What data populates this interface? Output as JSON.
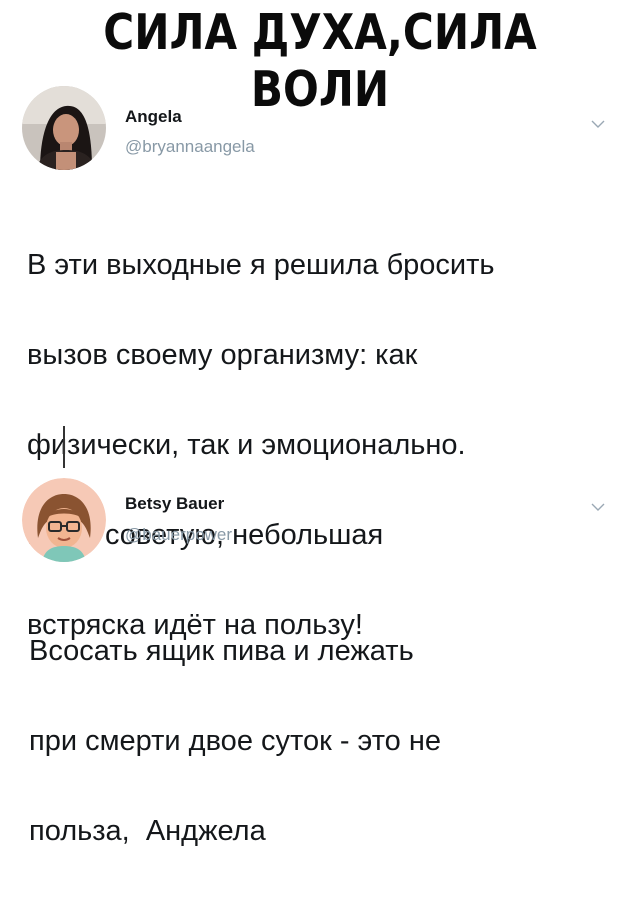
{
  "meme": {
    "title": "СИЛА ДУХА,СИЛА ВОЛИ"
  },
  "tweet1": {
    "name": "Angela",
    "handle": "@bryannaangela",
    "lines": [
      "В эти выходные я решила бросить",
      "вызов своему организму: как",
      "физически, так и эмоционально.",
      "Всем советую, небольшая",
      "встряска идёт на пользу!"
    ]
  },
  "tweet2": {
    "name": "Betsy Bauer",
    "handle": "@bauerpower",
    "lines": [
      "Всосать ящик пива и лежать",
      "при смерти двое суток - это не",
      "польза,  Анджела"
    ]
  },
  "colors": {
    "text": "#14171a",
    "muted": "#8899a6",
    "title": "#0b0b0b"
  },
  "icons": {
    "menu": "chevron-down-icon"
  }
}
